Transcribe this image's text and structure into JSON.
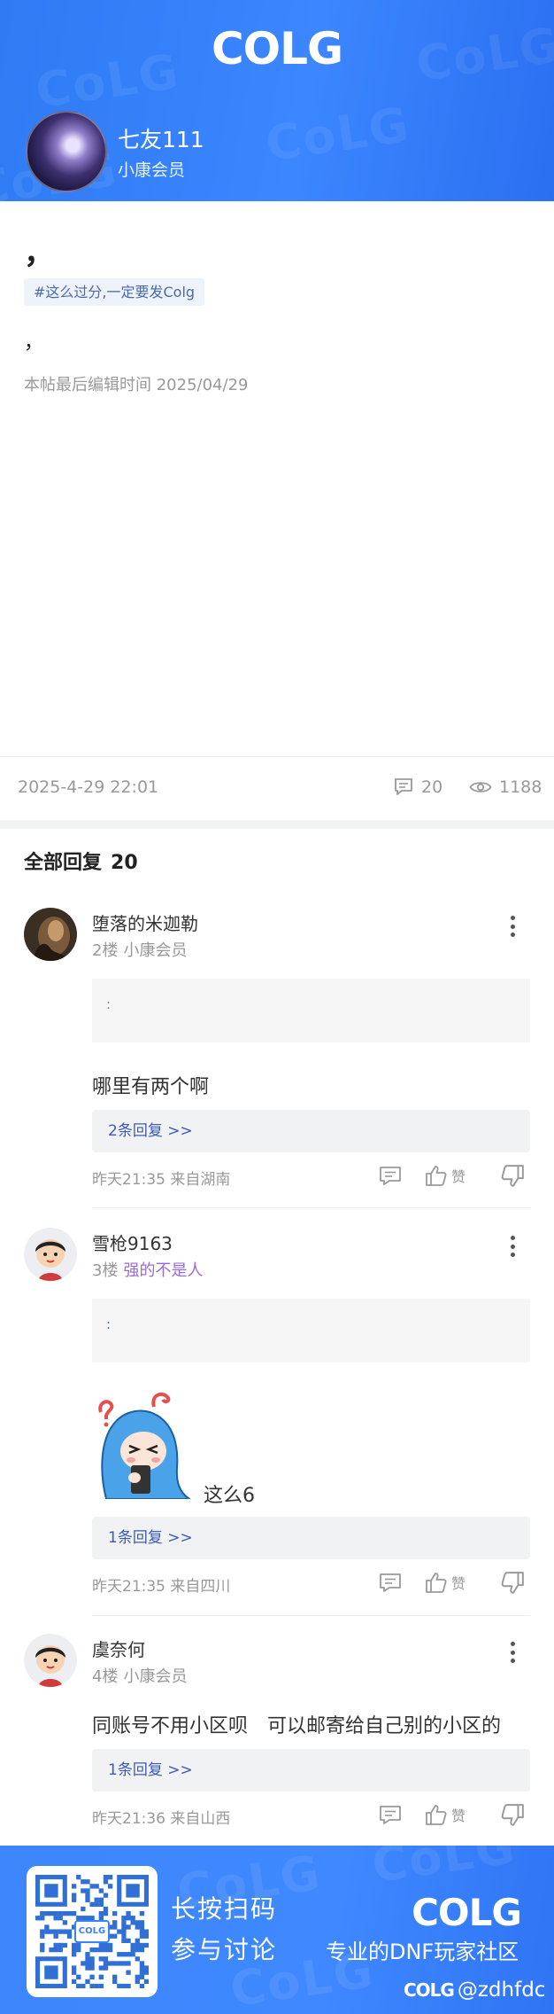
{
  "header": {
    "logo": "COLG",
    "author_name": "七友111",
    "author_role": "小康会员"
  },
  "post": {
    "line1": "，",
    "tag": "#这么过分,一定要发Colg",
    "line2": "，",
    "edit_time": "本帖最后编辑时间 2025/04/29",
    "date": "2025-4-29 22:01",
    "comment_count": "20",
    "view_count": "1188"
  },
  "replies": {
    "title": "全部回复",
    "count": "20",
    "items": [
      {
        "name": "堕落的米迦勒",
        "floor": "2楼",
        "level": "小康会员",
        "quote": ":",
        "text": "哪里有两个啊",
        "sub_replies": "2条回复 >>",
        "footer": "昨天21:35 来自湖南",
        "like": "赞"
      },
      {
        "name": "雪枪9163",
        "floor": "3楼",
        "level": "强的不是人",
        "quote": ":",
        "text": "这么6",
        "sub_replies": "1条回复 >>",
        "footer": "昨天21:35 来自四川",
        "like": "赞"
      },
      {
        "name": "虞奈何",
        "floor": "4楼",
        "level": "小康会员",
        "text": "同账号不用小区呗　可以邮寄给自己别的小区的",
        "sub_replies": "1条回复 >>",
        "footer": "昨天21:36 来自山西",
        "like": "赞"
      }
    ]
  },
  "footer": {
    "qr_badge": "COLG",
    "scan_line1": "长按扫码",
    "scan_line2": "参与讨论",
    "logo": "COLG",
    "slogan": "专业的DNF玩家社区",
    "handle_logo": "COLG",
    "handle": "@zdhfdc"
  },
  "colors": {
    "brand_blue": "#3c86ff",
    "link_blue": "#3b5bb5",
    "level_purple": "#9a6ad6",
    "muted": "#999999"
  },
  "icons": [
    "comment-icon",
    "eye-icon",
    "more-icon",
    "reply-icon",
    "thumbs-up-icon",
    "thumbs-down-icon",
    "qr-code"
  ]
}
